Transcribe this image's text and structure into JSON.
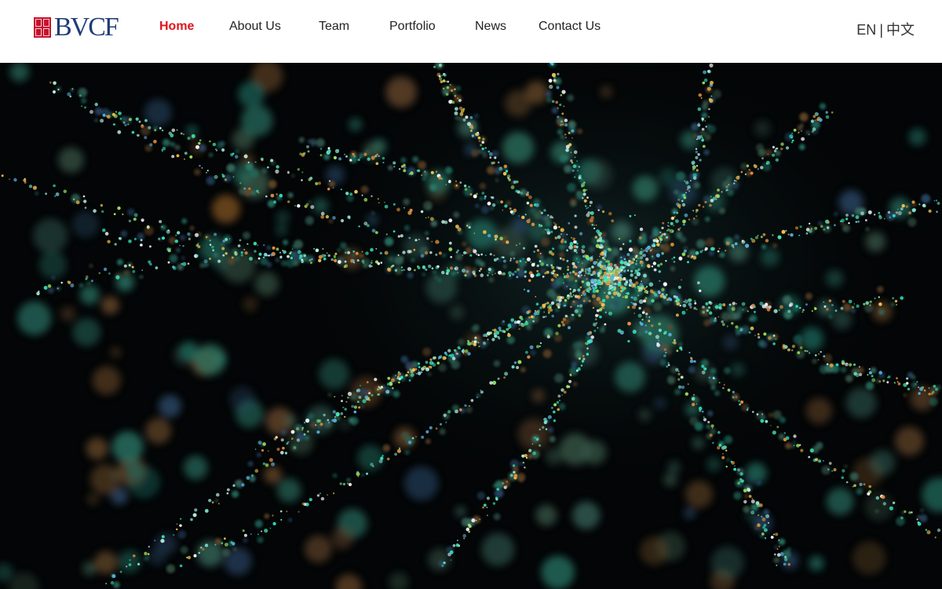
{
  "brand": {
    "logo_text": "BVCF",
    "seal_icon": "seal-icon"
  },
  "nav": {
    "items": [
      {
        "label": "Home",
        "active": true
      },
      {
        "label": "About Us",
        "active": false
      },
      {
        "label": "Team",
        "active": false
      },
      {
        "label": "Portfolio",
        "active": false
      },
      {
        "label": "News",
        "active": false
      },
      {
        "label": "Contact Us",
        "active": false
      }
    ]
  },
  "lang": {
    "en": "EN",
    "separator": "|",
    "zh": "中文"
  },
  "colors": {
    "active_nav": "#e0141e",
    "brand_blue": "#1f3c78",
    "seal_red": "#c8102e",
    "hero_bg": "#030506"
  },
  "hero": {
    "image": "neuron-particles-background"
  }
}
